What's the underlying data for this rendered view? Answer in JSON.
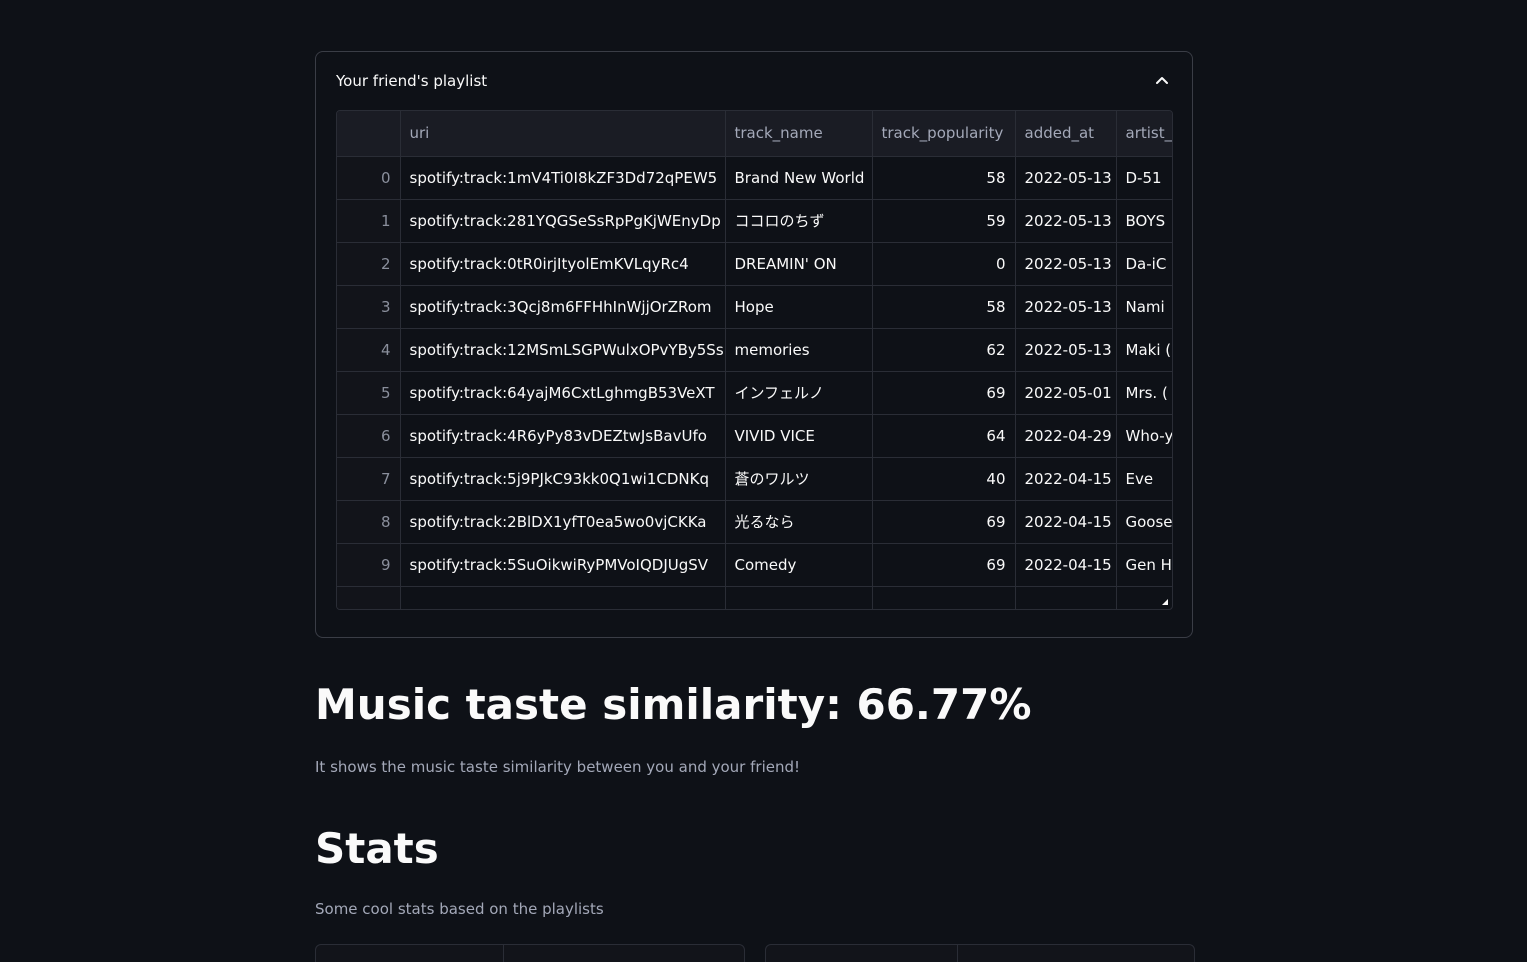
{
  "expander": {
    "title": "Your friend's playlist",
    "icon": "chevron-up-icon"
  },
  "table": {
    "columns": [
      "uri",
      "track_name",
      "track_popularity",
      "added_at",
      "artist_"
    ],
    "rows": [
      {
        "index": "0",
        "uri": "spotify:track:1mV4Ti0I8kZF3Dd72qPEW5",
        "track_name": "Brand New World",
        "track_popularity": "58",
        "added_at": "2022-05-13",
        "artist": "D-51"
      },
      {
        "index": "1",
        "uri": "spotify:track:281YQGSeSsRpPgKjWEnyDp",
        "track_name": "ココロのちず",
        "track_popularity": "59",
        "added_at": "2022-05-13",
        "artist": "BOYS"
      },
      {
        "index": "2",
        "uri": "spotify:track:0tR0irjItyolEmKVLqyRc4",
        "track_name": "DREAMIN' ON",
        "track_popularity": "0",
        "added_at": "2022-05-13",
        "artist": "Da-iC"
      },
      {
        "index": "3",
        "uri": "spotify:track:3Qcj8m6FFHhInWjjOrZRom",
        "track_name": "Hope",
        "track_popularity": "58",
        "added_at": "2022-05-13",
        "artist": "Nami"
      },
      {
        "index": "4",
        "uri": "spotify:track:12MSmLSGPWulxOPvYBy5Ss",
        "track_name": "memories",
        "track_popularity": "62",
        "added_at": "2022-05-13",
        "artist": "Maki ("
      },
      {
        "index": "5",
        "uri": "spotify:track:64yajM6CxtLghmgB53VeXT",
        "track_name": "インフェルノ",
        "track_popularity": "69",
        "added_at": "2022-05-01",
        "artist": "Mrs. ("
      },
      {
        "index": "6",
        "uri": "spotify:track:4R6yPy83vDEZtwJsBavUfo",
        "track_name": "VIVID VICE",
        "track_popularity": "64",
        "added_at": "2022-04-29",
        "artist": "Who-y"
      },
      {
        "index": "7",
        "uri": "spotify:track:5j9PJkC93kk0Q1wi1CDNKq",
        "track_name": "蒼のワルツ",
        "track_popularity": "40",
        "added_at": "2022-04-15",
        "artist": "Eve"
      },
      {
        "index": "8",
        "uri": "spotify:track:2BlDX1yfT0ea5wo0vjCKKa",
        "track_name": "光るなら",
        "track_popularity": "69",
        "added_at": "2022-04-15",
        "artist": "Goose"
      },
      {
        "index": "9",
        "uri": "spotify:track:5SuOikwiRyPMVoIQDJUgSV",
        "track_name": "Comedy",
        "track_popularity": "69",
        "added_at": "2022-04-15",
        "artist": "Gen H"
      }
    ]
  },
  "similarity": {
    "heading": "Music taste similarity: 66.77%",
    "caption": "It shows the music taste similarity between you and your friend!"
  },
  "stats": {
    "heading": "Stats",
    "caption": "Some cool stats based on the playlists"
  },
  "colors": {
    "background": "#0e1117",
    "text": "#fafafa",
    "muted_text": "#a3a8b8",
    "border": "#2a2d36"
  }
}
